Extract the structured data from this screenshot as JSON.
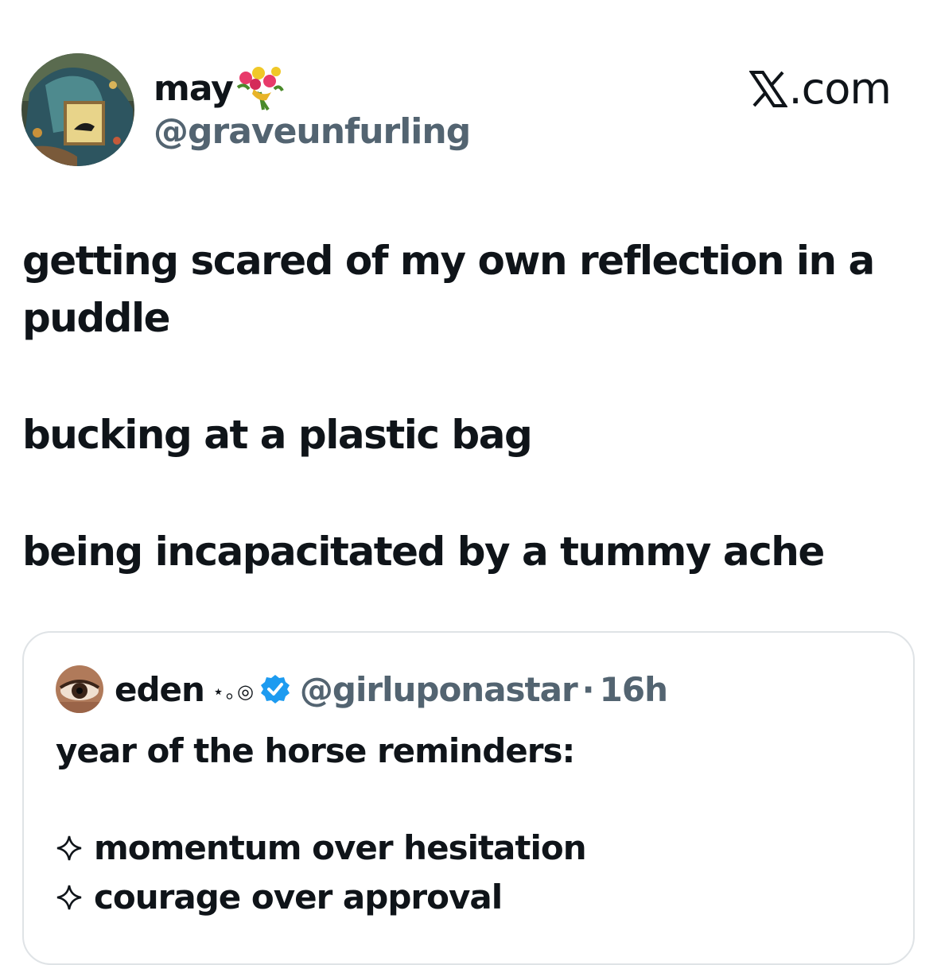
{
  "tweet": {
    "author": {
      "display_name": "may",
      "display_name_emoji": "bouquet-emoji",
      "handle": "@graveunfurling",
      "avatar": "avatar-painting"
    },
    "source_watermark": ".com",
    "body_lines": [
      "getting scared of my own reflection in a",
      "puddle",
      "bucking at a plastic bag",
      "being incapacitated by a tummy ache"
    ]
  },
  "quoted_tweet": {
    "author": {
      "display_name": "eden",
      "name_decoration": "⋆｡◎",
      "verified": true,
      "handle": "@girluponastar",
      "separator": "·",
      "timestamp": "16h"
    },
    "body_lines": [
      "year of the horse reminders:",
      "momentum over hesitation",
      "courage over approval"
    ],
    "bullet_icon": "sparkle-icon"
  },
  "colors": {
    "primary_text": "#0f1419",
    "secondary_text": "#536471",
    "border": "#dfe3e6",
    "verified_blue": "#1d9bf0"
  }
}
